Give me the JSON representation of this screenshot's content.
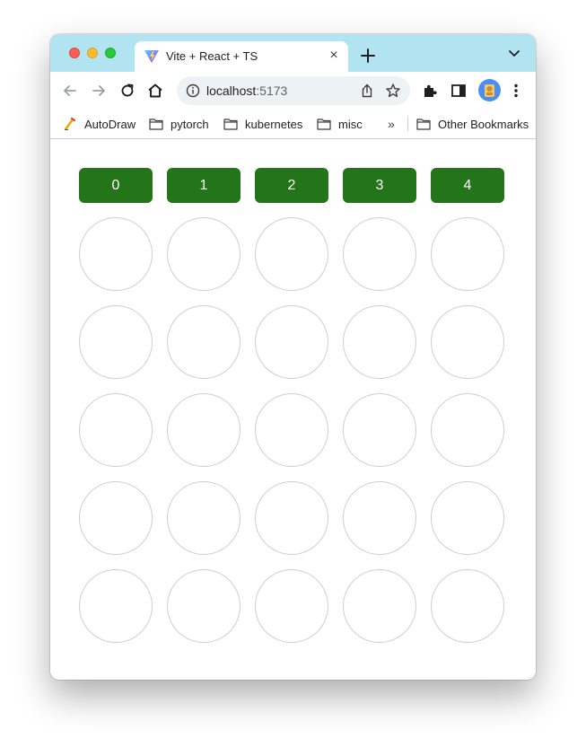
{
  "browser": {
    "tab": {
      "title": "Vite + React + TS",
      "favicon": "vite-logo-icon",
      "close_symbol": "×"
    },
    "tabstrip_color": "#b2e3f1",
    "address_bar": {
      "host": "localhost",
      "port": ":5173"
    },
    "bookmarks": [
      {
        "label": "AutoDraw",
        "icon": "autodraw-icon"
      },
      {
        "label": "pytorch",
        "icon": "folder-icon"
      },
      {
        "label": "kubernetes",
        "icon": "folder-icon"
      },
      {
        "label": "misc",
        "icon": "folder-icon"
      }
    ],
    "bookmarks_overflow": "»",
    "other_bookmarks": "Other Bookmarks"
  },
  "game": {
    "column_buttons": [
      "0",
      "1",
      "2",
      "3",
      "4"
    ],
    "button_color": "#247519",
    "rows": 5,
    "columns": 5
  }
}
